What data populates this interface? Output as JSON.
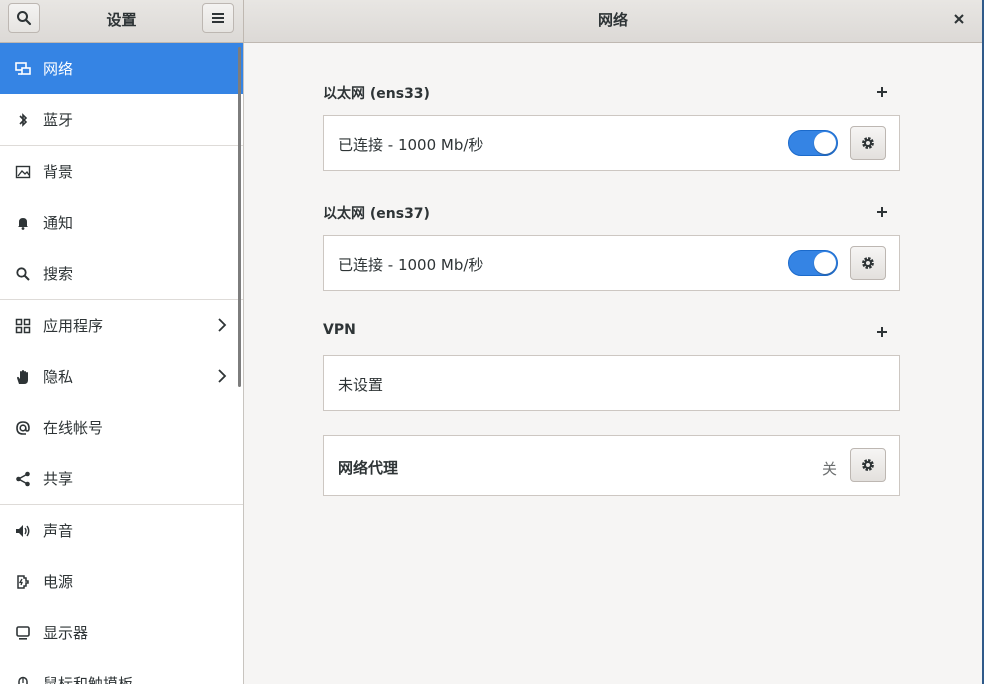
{
  "header": {
    "sidebar_title": "设置",
    "main_title": "网络"
  },
  "sidebar": {
    "items": [
      {
        "label": "网络",
        "icon": "network-icon"
      },
      {
        "label": "蓝牙",
        "icon": "bluetooth-icon"
      },
      {
        "label": "背景",
        "icon": "background-icon"
      },
      {
        "label": "通知",
        "icon": "bell-icon"
      },
      {
        "label": "搜索",
        "icon": "search-icon"
      },
      {
        "label": "应用程序",
        "icon": "apps-grid-icon"
      },
      {
        "label": "隐私",
        "icon": "hand-icon"
      },
      {
        "label": "在线帐号",
        "icon": "at-icon"
      },
      {
        "label": "共享",
        "icon": "share-icon"
      },
      {
        "label": "声音",
        "icon": "speaker-icon"
      },
      {
        "label": "电源",
        "icon": "power-plug-icon"
      },
      {
        "label": "显示器",
        "icon": "display-icon"
      },
      {
        "label": "鼠标和触摸板",
        "icon": "mouse-icon"
      }
    ]
  },
  "main": {
    "ethernet1": {
      "title": "以太网 (ens33)",
      "status": "已连接 - 1000 Mb/秒"
    },
    "ethernet2": {
      "title": "以太网 (ens37)",
      "status": "已连接 - 1000 Mb/秒"
    },
    "vpn": {
      "title": "VPN",
      "status": "未设置"
    },
    "proxy": {
      "title": "网络代理",
      "state": "关"
    }
  },
  "colors": {
    "accent": "#3584e4"
  }
}
